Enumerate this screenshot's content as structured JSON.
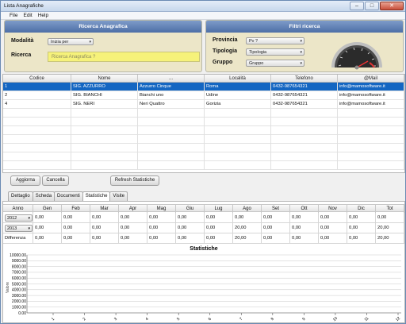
{
  "window": {
    "title": "Lista Anagrafiche",
    "min": "–",
    "max": "□",
    "close": "✕"
  },
  "menu": [
    "File",
    "Edit",
    "Help"
  ],
  "search_panel": {
    "header": "Ricerca Anagrafica",
    "mode_label": "Modalità",
    "mode_value": "Inizia per",
    "search_label": "Ricerca",
    "search_placeholder": "Ricerca Anagrafica ?"
  },
  "filter_panel": {
    "header": "Filtri ricerca",
    "province_label": "Provincia",
    "province_value": "Pv ?",
    "type_label": "Tipologia",
    "type_value": "Tipologia",
    "group_label": "Gruppo",
    "group_value": "Gruppo",
    "gauge_icon": "speedometer-icon"
  },
  "table": {
    "columns": [
      "Codice",
      "Nome",
      "...",
      "Località",
      "Telefono",
      "@Mail"
    ],
    "rows": [
      {
        "code": "1",
        "name": "SIG. AZZURRO",
        "extra": "Azzurro Cinque",
        "city": "Roma",
        "phone": "0432-987654321",
        "mail": "info@mamosoftware.it",
        "selected": true
      },
      {
        "code": "2",
        "name": "SIG. BIANCHI",
        "extra": "Bianchi uno",
        "city": "Udine",
        "phone": "0432-987654321",
        "mail": "info@mamosoftware.it",
        "selected": false
      },
      {
        "code": "4",
        "name": "SIG. NERI",
        "extra": "Neri Quattro",
        "city": "Gorizia",
        "phone": "0432-987654321",
        "mail": "info@mamosoftware.it",
        "selected": false
      }
    ]
  },
  "buttons": {
    "update": "Aggiorna",
    "cancel": "Cancella",
    "refresh_stats": "Refresh Statistiche"
  },
  "tabs": [
    {
      "label": "Dettaglio",
      "active": false
    },
    {
      "label": "Scheda",
      "active": false
    },
    {
      "label": "Documenti",
      "active": false
    },
    {
      "label": "Statistiche",
      "active": true
    },
    {
      "label": "Visite",
      "active": false
    }
  ],
  "stats": {
    "columns": [
      "Anno",
      "Gen",
      "Feb",
      "Mar",
      "Apr",
      "Mag",
      "Giu",
      "Lug",
      "Ago",
      "Set",
      "Ott",
      "Nov",
      "Dic",
      "Tot"
    ],
    "rows": [
      {
        "year": "2012",
        "values": [
          "0,00",
          "0,00",
          "0,00",
          "0,00",
          "0,00",
          "0,00",
          "0,00",
          "0,00",
          "0,00",
          "0,00",
          "0,00",
          "0,00",
          "0,00"
        ]
      },
      {
        "year": "2013",
        "values": [
          "0,00",
          "0,00",
          "0,00",
          "0,00",
          "0,00",
          "0,00",
          "0,00",
          "20,00",
          "0,00",
          "0,00",
          "0,00",
          "0,00",
          "20,00"
        ]
      },
      {
        "year": "Differenza",
        "values": [
          "0,00",
          "0,00",
          "0,00",
          "0,00",
          "0,00",
          "0,00",
          "0,00",
          "20,00",
          "0,00",
          "0,00",
          "0,00",
          "0,00",
          "20,00"
        ]
      }
    ]
  },
  "chart_data": {
    "type": "line",
    "title": "Statistiche",
    "x": [
      1,
      2,
      3,
      4,
      5,
      6,
      7,
      8,
      9,
      10,
      11,
      12
    ],
    "x_tick_labels": [
      "1",
      "2",
      "3",
      "4",
      "5",
      "6",
      "7",
      "8",
      "9",
      "10",
      "11",
      "12"
    ],
    "y_tick_labels": [
      "10000.00",
      "9000.00",
      "8000.00",
      "7000.00",
      "6000.00",
      "5000.00",
      "4000.00",
      "3000.00",
      "2000.00",
      "1000.00",
      "0.00"
    ],
    "ylim": [
      0,
      10000
    ],
    "ylabel": "Valore",
    "series": [],
    "grid": true
  }
}
